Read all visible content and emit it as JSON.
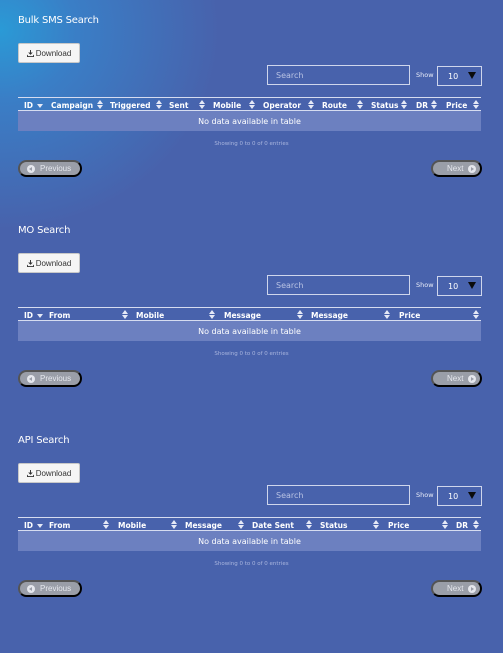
{
  "sections": [
    {
      "title": "Bulk SMS Search",
      "download_label": "Download",
      "search_placeholder": "Search",
      "show_label": "Show",
      "show_value": "10",
      "columns": [
        "ID",
        "Campaign",
        "Triggered",
        "Sent",
        "Mobile",
        "Operator",
        "Route",
        "Status",
        "DR",
        "Price"
      ],
      "empty_text": "No data available in table",
      "info_text": "Showing 0 to 0 of 0 entries",
      "prev_label": "Previous",
      "next_label": "Next"
    },
    {
      "title": "MO Search",
      "download_label": "Download",
      "search_placeholder": "Search",
      "show_label": "Show",
      "show_value": "10",
      "columns": [
        "ID",
        "From",
        "Mobile",
        "Message",
        "Message",
        "Price"
      ],
      "empty_text": "No data available in table",
      "info_text": "Showing 0 to 0 of 0 entries",
      "prev_label": "Previous",
      "next_label": "Next"
    },
    {
      "title": "API Search",
      "download_label": "Download",
      "search_placeholder": "Search",
      "show_label": "Show",
      "show_value": "10",
      "columns": [
        "ID",
        "From",
        "Mobile",
        "Message",
        "Date Sent",
        "Status",
        "Price",
        "DR"
      ],
      "empty_text": "No data available in table",
      "info_text": "Showing 0 to 0 of 0 entries",
      "prev_label": "Previous",
      "next_label": "Next"
    }
  ],
  "colors": {
    "background": "#4862ac",
    "gradient_accent": "#2a9ad6",
    "table_row": "#6c80c0",
    "pager_button": "#9a9ea8"
  },
  "icons": {
    "download": "download-icon",
    "previous": "chevron-left-circle-icon",
    "next": "chevron-right-circle-icon",
    "sort": "sort-icon",
    "dropdown": "caret-down-icon"
  }
}
